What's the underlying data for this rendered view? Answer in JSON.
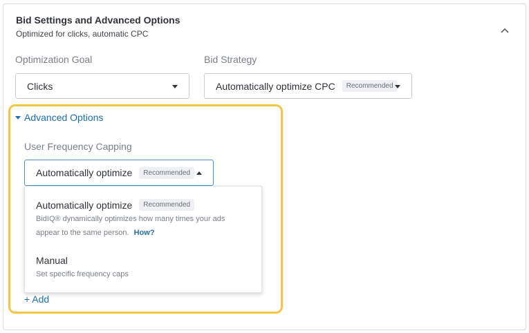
{
  "panel": {
    "title": "Bid Settings and Advanced Options",
    "subtitle": "Optimized for clicks, automatic CPC"
  },
  "optimization_goal": {
    "label": "Optimization Goal",
    "value": "Clicks"
  },
  "bid_strategy": {
    "label": "Bid Strategy",
    "value": "Automatically optimize CPC",
    "badge": "Recommended"
  },
  "advanced_options": {
    "toggle_label": "Advanced Options",
    "frequency_capping": {
      "label": "User Frequency Capping",
      "value": "Automatically optimize",
      "badge": "Recommended",
      "options": [
        {
          "title": "Automatically optimize",
          "badge": "Recommended",
          "desc_line1": "BidIQ® dynamically optimizes how many times your ads",
          "desc_line2": "appear to the same person.",
          "link": "How?"
        },
        {
          "title": "Manual",
          "desc_line1": "Set specific frequency caps"
        }
      ]
    },
    "add_label": "+ Add"
  },
  "icons": {
    "collapse": "chevron-up-icon",
    "dropdown_closed": "caret-down-icon",
    "dropdown_open": "caret-up-icon",
    "section_toggle": "triangle-down-icon"
  },
  "colors": {
    "link": "#1c6fa8",
    "highlight": "#f5c443",
    "focus_border": "#4a90c2"
  }
}
